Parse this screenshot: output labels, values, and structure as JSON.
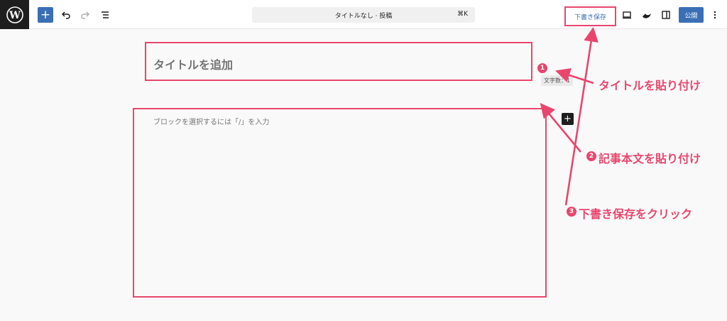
{
  "toolbar": {
    "command_title": "タイトルなし · 投稿",
    "command_shortcut": "⌘K",
    "save_draft_label": "下書き保存",
    "publish_label": "公開"
  },
  "editor": {
    "title_placeholder": "タイトルを追加",
    "char_count": "文字数：1",
    "body_placeholder": "ブロックを選択するには「/」を入力"
  },
  "annotations": {
    "step1_number": "1",
    "step1_label": "タイトルを貼り付け",
    "step2_number": "2",
    "step2_label": "記事本文を貼り付け",
    "step3_number": "3",
    "step3_label": "下書き保存をクリック",
    "accent_color": "#e9466d"
  },
  "icons": [
    "wordpress-logo",
    "plus-icon",
    "undo-icon",
    "redo-icon",
    "list-view-icon",
    "desktop-preview-icon",
    "style-icon",
    "sidebar-toggle-icon",
    "more-options-icon",
    "block-add-icon"
  ]
}
